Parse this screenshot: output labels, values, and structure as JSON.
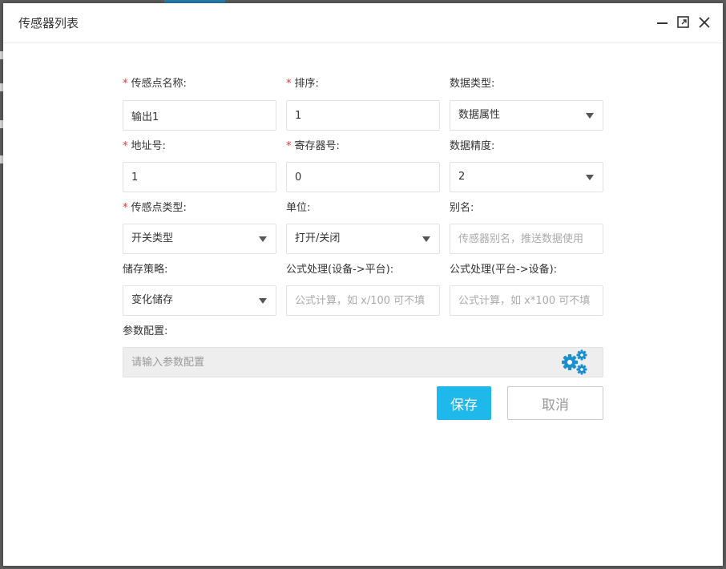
{
  "dialog": {
    "title": "传感器列表"
  },
  "form": {
    "sensor_name": {
      "label": "传感点名称:",
      "required": true,
      "value": "输出1"
    },
    "sort": {
      "label": "排序:",
      "required": true,
      "value": "1"
    },
    "data_type": {
      "label": "数据类型:",
      "required": false,
      "value": "数据属性"
    },
    "address": {
      "label": "地址号:",
      "required": true,
      "value": "1"
    },
    "register": {
      "label": "寄存器号:",
      "required": true,
      "value": "0"
    },
    "precision": {
      "label": "数据精度:",
      "required": false,
      "value": "2"
    },
    "sensor_type": {
      "label": "传感点类型:",
      "required": true,
      "value": "开关类型"
    },
    "unit": {
      "label": "单位:",
      "required": false,
      "value": "打开/关闭"
    },
    "alias": {
      "label": "别名:",
      "required": false,
      "value": "",
      "placeholder": "传感器别名，推送数据使用"
    },
    "storage": {
      "label": "储存策略:",
      "required": false,
      "value": "变化储存"
    },
    "formula_up": {
      "label": "公式处理(设备->平台):",
      "required": false,
      "value": "",
      "placeholder": "公式计算，如 x/100 可不填"
    },
    "formula_down": {
      "label": "公式处理(平台->设备):",
      "required": false,
      "value": "",
      "placeholder": "公式计算，如 x*100 可不填"
    },
    "params": {
      "label": "参数配置:",
      "required": false,
      "value": "",
      "placeholder": "请输入参数配置"
    }
  },
  "actions": {
    "save_label": "保存",
    "cancel_label": "取消"
  },
  "colors": {
    "accent": "#1fb8ea",
    "required": "#e4393c",
    "gear": "#1a8fd0"
  },
  "icons": {
    "minimize": "minimize-icon",
    "maximize": "maximize-icon",
    "close": "close-icon",
    "settings": "gears-icon",
    "dropdown": "caret-down-icon"
  }
}
